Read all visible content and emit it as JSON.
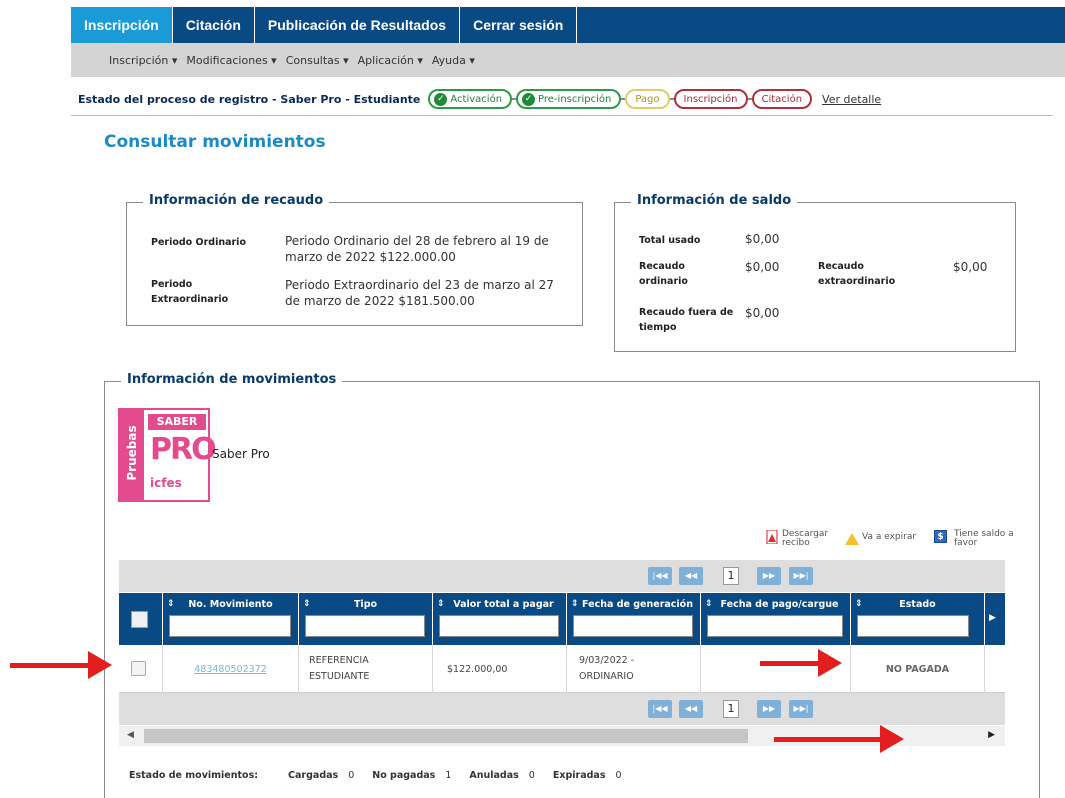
{
  "topnav": {
    "tabs": [
      {
        "label": "Inscripción",
        "active": true
      },
      {
        "label": "Citación",
        "active": false
      },
      {
        "label": "Publicación de Resultados",
        "active": false
      },
      {
        "label": "Cerrar sesión",
        "active": false
      }
    ]
  },
  "subnav": {
    "menus": [
      "Inscripción ▾",
      "Modificaciones ▾",
      "Consultas ▾",
      "Aplicación ▾",
      "Ayuda ▾"
    ]
  },
  "status": {
    "label": "Estado del proceso de registro - Saber Pro - Estudiante",
    "steps": [
      {
        "label": "Activación",
        "state": "done"
      },
      {
        "label": "Pre-inscripción",
        "state": "done"
      },
      {
        "label": "Pago",
        "state": "pending"
      },
      {
        "label": "Inscripción",
        "state": "todo"
      },
      {
        "label": "Citación",
        "state": "todo"
      }
    ],
    "detail_link": "Ver detalle"
  },
  "page_title": "Consultar movimientos",
  "recaudo": {
    "legend": "Información de recaudo",
    "ordinario_label": "Periodo Ordinario",
    "ordinario_value": "Periodo Ordinario del 28 de febrero al 19 de marzo de 2022 $122.000.00",
    "extra_label": "Periodo Extraordinario",
    "extra_value": "Periodo Extraordinario del 23 de marzo al 27 de marzo de 2022 $181.500.00"
  },
  "saldo": {
    "legend": "Información de saldo",
    "total_usado_label": "Total usado",
    "total_usado": "$0,00",
    "recaudo_ordinario_label": "Recaudo ordinario",
    "recaudo_ordinario": "$0,00",
    "recaudo_extra_label": "Recaudo extraordinario",
    "recaudo_extra": "$0,00",
    "fuera_label": "Recaudo fuera de tiempo",
    "fuera": "$0,00"
  },
  "movimientos": {
    "legend": "Información de movimientos",
    "logo": {
      "side": "Pruebas",
      "top": "SABER",
      "pro": "PRO",
      "bottom": "icfes"
    },
    "exam_name": "Saber Pro",
    "icon_legend": {
      "descargar": "Descargar recibo",
      "expirar": "Va a expirar",
      "saldo": "Tiene saldo a favor"
    },
    "pager": {
      "first": "|◀◀",
      "prev": "◀◀",
      "page": "1",
      "next": "▶▶",
      "last": "▶▶|"
    },
    "columns": [
      "No. Movimiento",
      "Tipo",
      "Valor total a pagar",
      "Fecha de generación",
      "Fecha de pago/cargue",
      "Estado"
    ],
    "rows": [
      {
        "numero": "483480502372",
        "tipo": "REFERENCIA ESTUDIANTE",
        "valor": "$122.000,00",
        "fecha_generacion": "9/03/2022 - ORDINARIO",
        "fecha_pago": "",
        "estado": "NO PAGADA"
      }
    ],
    "summary": {
      "label": "Estado de movimientos:",
      "cargadas_label": "Cargadas",
      "cargadas": "0",
      "no_pagadas_label": "No pagadas",
      "no_pagadas": "1",
      "anuladas_label": "Anuladas",
      "anuladas": "0",
      "expiradas_label": "Expiradas",
      "expiradas": "0"
    }
  },
  "colors": {
    "nav": "#0a4a84",
    "nav_active": "#1a9ad6",
    "title": "#1c8ac4",
    "brand_pink": "#e24b8e",
    "arrow_red": "#e31e1e"
  }
}
